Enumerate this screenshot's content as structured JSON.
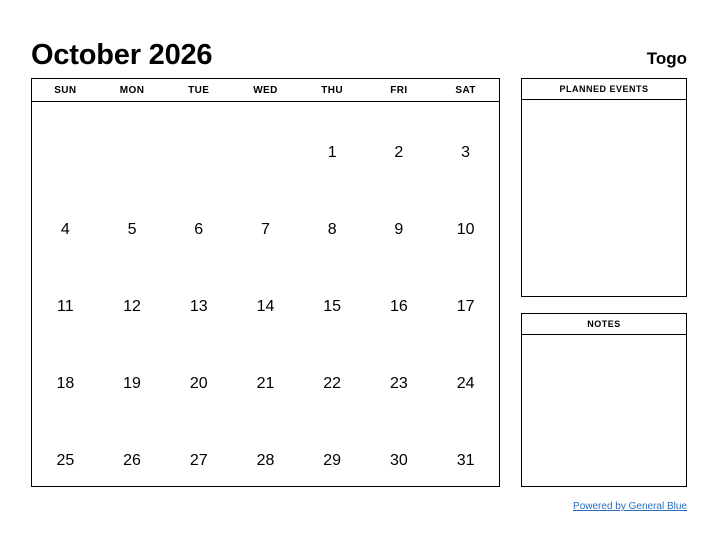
{
  "header": {
    "month_title": "October 2026",
    "country": "Togo"
  },
  "calendar": {
    "weekday_headers": [
      "SUN",
      "MON",
      "TUE",
      "WED",
      "THU",
      "FRI",
      "SAT"
    ],
    "weeks": [
      [
        "",
        "",
        "",
        "",
        "1",
        "2",
        "3"
      ],
      [
        "4",
        "5",
        "6",
        "7",
        "8",
        "9",
        "10"
      ],
      [
        "11",
        "12",
        "13",
        "14",
        "15",
        "16",
        "17"
      ],
      [
        "18",
        "19",
        "20",
        "21",
        "22",
        "23",
        "24"
      ],
      [
        "25",
        "26",
        "27",
        "28",
        "29",
        "30",
        "31"
      ]
    ]
  },
  "panels": {
    "planned_events": {
      "title": "PLANNED EVENTS",
      "content": ""
    },
    "notes": {
      "title": "NOTES",
      "content": ""
    }
  },
  "footer": {
    "link_label": "Powered by General Blue"
  },
  "colors": {
    "text": "#000000",
    "background": "#ffffff",
    "border": "#000000",
    "link": "#2a6ebb"
  }
}
